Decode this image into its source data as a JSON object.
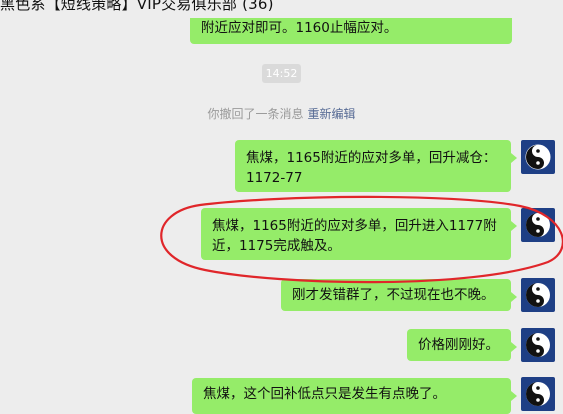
{
  "window": {
    "title": "黑色系【短线策略】VIP交易俱乐部 (36)"
  },
  "chat": {
    "time_badge": "14:52",
    "recall_notice": "你撤回了一条消息",
    "reedit_link": "重新编辑",
    "messages": [
      {
        "text": "附近应对即可。1160止幅应对。"
      },
      {
        "line1": "焦煤，1165附近的应对多单，回升减仓：",
        "line2": "1172-77"
      },
      {
        "line1": "焦煤，1165附近的应对多单，回升进入1177附",
        "line2": "近，1175完成触及。"
      },
      {
        "text": "刚才发错群了，不过现在也不晚。"
      },
      {
        "text": "价格刚刚好。"
      },
      {
        "text": "焦煤，这个回补低点只是发生有点晚了。"
      }
    ]
  },
  "icons": {
    "avatar": "yin-yang-icon"
  },
  "colors": {
    "bubble_green": "#95ec69",
    "annotation_red": "#e0262a",
    "avatar_blue": "#1e3f85",
    "link_blue": "#576b95"
  }
}
